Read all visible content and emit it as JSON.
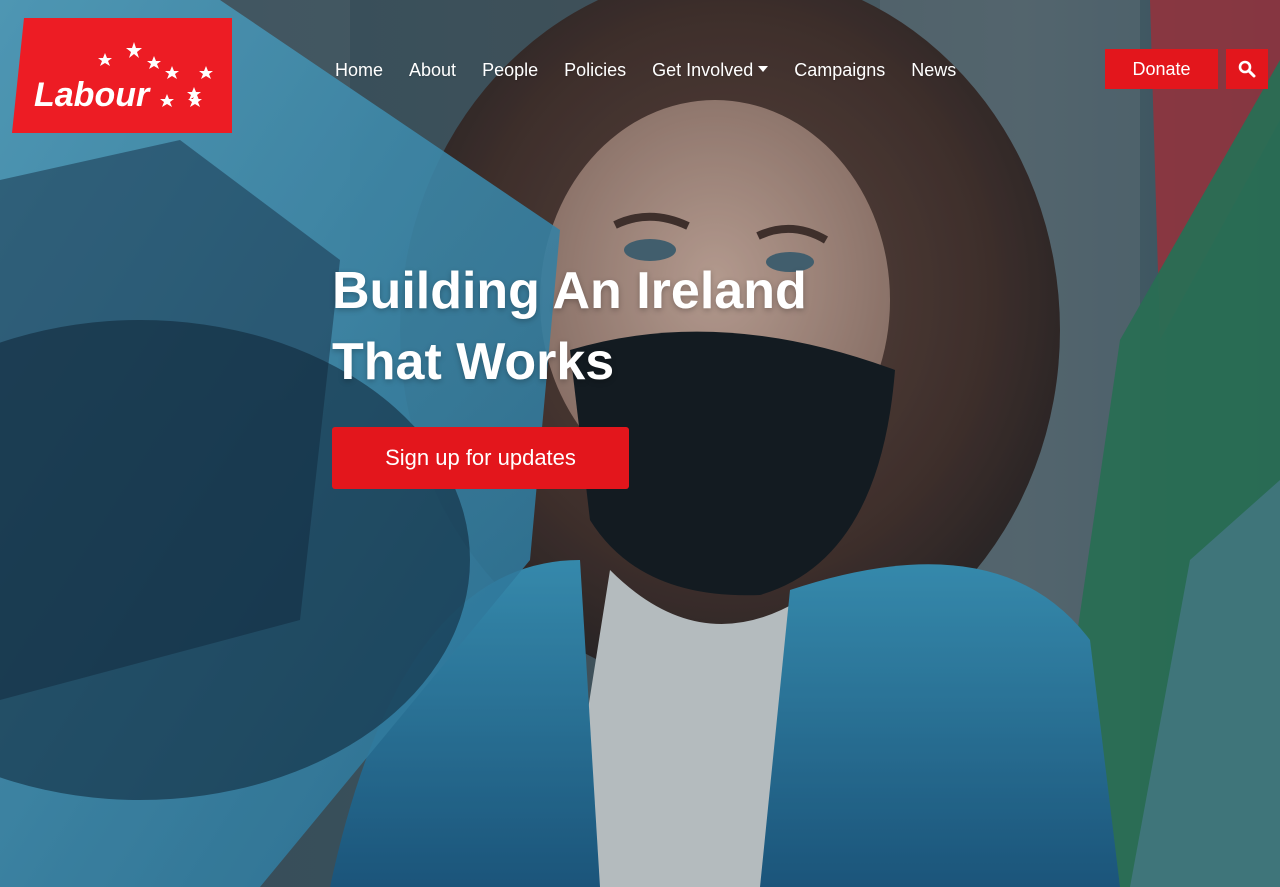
{
  "brand": {
    "logo_text": "Labour",
    "logo_color": "#ed1c24"
  },
  "nav": {
    "items": [
      {
        "label": "Home"
      },
      {
        "label": "About"
      },
      {
        "label": "People"
      },
      {
        "label": "Policies"
      },
      {
        "label": "Get Involved",
        "has_dropdown": true
      },
      {
        "label": "Campaigns"
      },
      {
        "label": "News"
      }
    ]
  },
  "header": {
    "donate_label": "Donate",
    "search_icon": "search-icon"
  },
  "hero": {
    "headline_line1": "Building An Ireland",
    "headline_line2": "That Works",
    "cta_label": "Sign up for updates",
    "background": "photo-of-protester-in-face-mask"
  },
  "colors": {
    "accent": "#e3161c",
    "text_on_hero": "#ffffff"
  }
}
